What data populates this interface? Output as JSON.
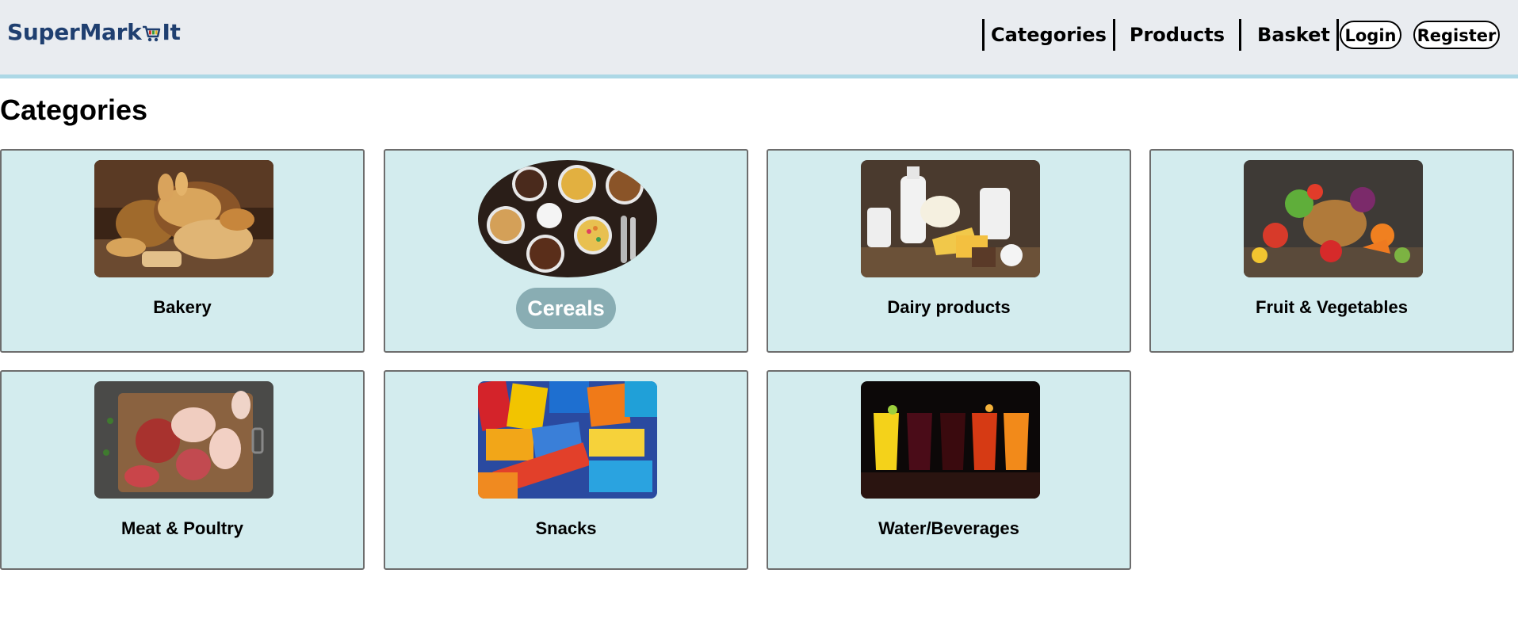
{
  "header": {
    "logo_text_left": "SuperMark",
    "logo_text_right": "It",
    "logo_icon": "shopping-cart-icon",
    "nav": {
      "categories": "Categories",
      "products": "Products",
      "basket": "Basket"
    },
    "login": "Login",
    "register": "Register"
  },
  "main": {
    "title": "Categories",
    "categories": [
      {
        "label": "Bakery",
        "image": "bakery-image"
      },
      {
        "label": "Cereals",
        "image": "cereals-image",
        "hovered": true
      },
      {
        "label": "Dairy products",
        "image": "dairy-image"
      },
      {
        "label": "Fruit & Vegetables",
        "image": "fruit-vegetables-image"
      },
      {
        "label": "Meat & Poultry",
        "image": "meat-poultry-image"
      },
      {
        "label": "Snacks",
        "image": "snacks-image"
      },
      {
        "label": "Water/Beverages",
        "image": "beverages-image"
      }
    ]
  },
  "colors": {
    "header_bg": "#e9ecf0",
    "header_border": "#add8e6",
    "card_bg": "#d3ecee",
    "card_border": "#6d6d6d",
    "hover_pill": "#89adb3",
    "logo": "#1f3f70"
  }
}
